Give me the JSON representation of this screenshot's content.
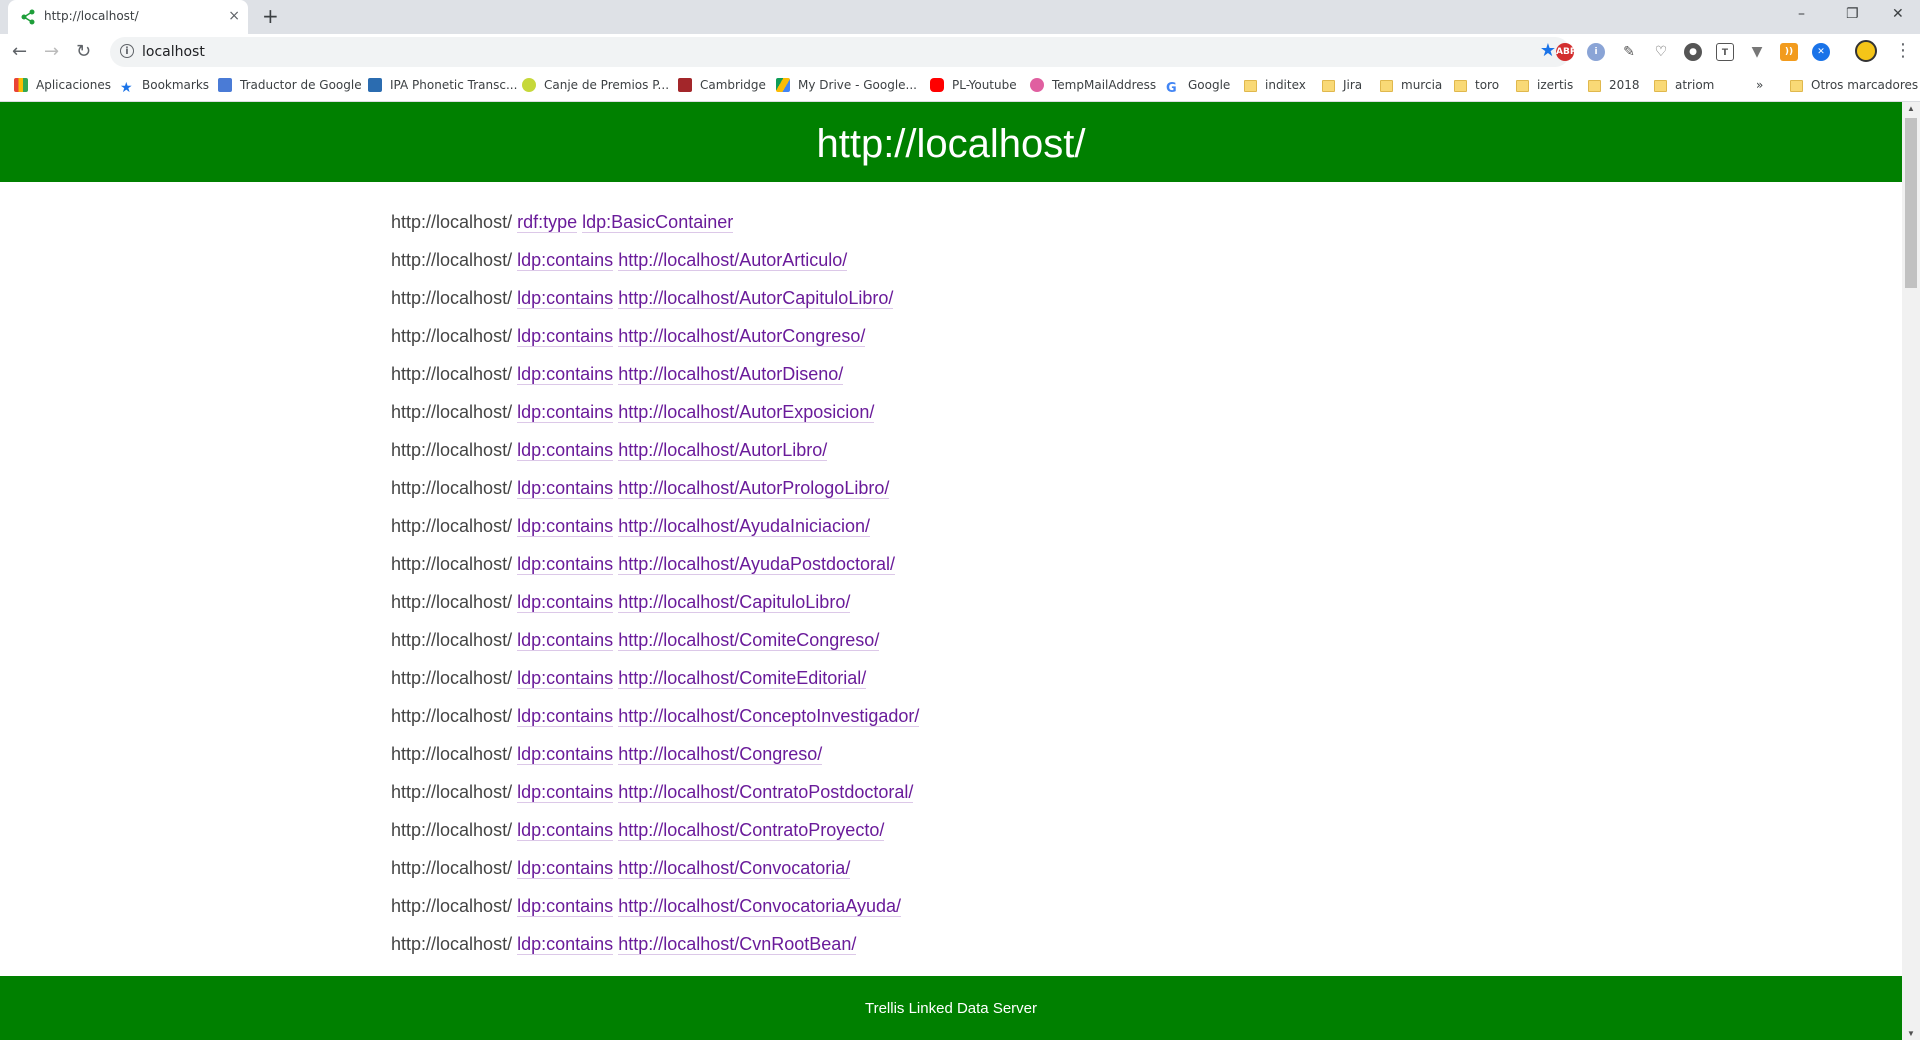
{
  "browser": {
    "tab_title": "http://localhost/",
    "tab_close": "×",
    "new_tab": "+",
    "url": "localhost",
    "window": {
      "minimize": "–",
      "restore": "❐",
      "close": "✕"
    }
  },
  "bookmarks": [
    {
      "label": "Aplicaciones",
      "icon": "apps-grid-icon"
    },
    {
      "label": "Bookmarks",
      "icon": "star-icon"
    },
    {
      "label": "Traductor de Google",
      "icon": "translate-icon"
    },
    {
      "label": "IPA Phonetic Transc...",
      "icon": "ipa-icon"
    },
    {
      "label": "Canje de Premios P...",
      "icon": "reward-icon"
    },
    {
      "label": "Cambridge",
      "icon": "cambridge-shield-icon"
    },
    {
      "label": "My Drive - Google...",
      "icon": "drive-icon"
    },
    {
      "label": "PL-Youtube",
      "icon": "youtube-icon"
    },
    {
      "label": "TempMailAddress",
      "icon": "smiley-icon"
    },
    {
      "label": "Google",
      "icon": "google-icon"
    },
    {
      "label": "inditex",
      "icon": "folder-icon"
    },
    {
      "label": "Jira",
      "icon": "folder-icon"
    },
    {
      "label": "murcia",
      "icon": "folder-icon"
    },
    {
      "label": "toro",
      "icon": "folder-icon"
    },
    {
      "label": "izertis",
      "icon": "folder-icon"
    },
    {
      "label": "2018",
      "icon": "folder-icon"
    },
    {
      "label": "atriom",
      "icon": "folder-icon"
    }
  ],
  "bookmarks_overflow": "»",
  "other_bookmarks": "Otros marcadores",
  "page": {
    "title": "http://localhost/",
    "footer": "Trellis Linked Data Server",
    "subject": "http://localhost/",
    "rows": [
      {
        "predicate": "rdf:type",
        "object": "ldp:BasicContainer"
      },
      {
        "predicate": "ldp:contains",
        "object": "http://localhost/AutorArticulo/"
      },
      {
        "predicate": "ldp:contains",
        "object": "http://localhost/AutorCapituloLibro/"
      },
      {
        "predicate": "ldp:contains",
        "object": "http://localhost/AutorCongreso/"
      },
      {
        "predicate": "ldp:contains",
        "object": "http://localhost/AutorDiseno/"
      },
      {
        "predicate": "ldp:contains",
        "object": "http://localhost/AutorExposicion/"
      },
      {
        "predicate": "ldp:contains",
        "object": "http://localhost/AutorLibro/"
      },
      {
        "predicate": "ldp:contains",
        "object": "http://localhost/AutorPrologoLibro/"
      },
      {
        "predicate": "ldp:contains",
        "object": "http://localhost/AyudaIniciacion/"
      },
      {
        "predicate": "ldp:contains",
        "object": "http://localhost/AyudaPostdoctoral/"
      },
      {
        "predicate": "ldp:contains",
        "object": "http://localhost/CapituloLibro/"
      },
      {
        "predicate": "ldp:contains",
        "object": "http://localhost/ComiteCongreso/"
      },
      {
        "predicate": "ldp:contains",
        "object": "http://localhost/ComiteEditorial/"
      },
      {
        "predicate": "ldp:contains",
        "object": "http://localhost/ConceptoInvestigador/"
      },
      {
        "predicate": "ldp:contains",
        "object": "http://localhost/Congreso/"
      },
      {
        "predicate": "ldp:contains",
        "object": "http://localhost/ContratoPostdoctoral/"
      },
      {
        "predicate": "ldp:contains",
        "object": "http://localhost/ContratoProyecto/"
      },
      {
        "predicate": "ldp:contains",
        "object": "http://localhost/Convocatoria/"
      },
      {
        "predicate": "ldp:contains",
        "object": "http://localhost/ConvocatoriaAyuda/"
      },
      {
        "predicate": "ldp:contains",
        "object": "http://localhost/CvnRootBean/"
      }
    ]
  },
  "colors": {
    "header_green": "#008000",
    "link_purple": "#6a1b9a"
  }
}
